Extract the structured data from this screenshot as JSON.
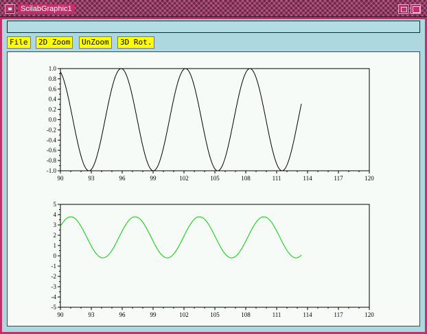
{
  "window": {
    "title": "ScilabGraphic1"
  },
  "menu": [
    {
      "name": "menu-file",
      "label": "File"
    },
    {
      "name": "menu-2d-zoom",
      "label": "2D Zoom"
    },
    {
      "name": "menu-unzoom",
      "label": "UnZoom"
    },
    {
      "name": "menu-3d-rot",
      "label": "3D Rot."
    }
  ],
  "info_text": "",
  "colors": {
    "plot1_line": "#000000",
    "plot2_line": "#00cc00",
    "canvas_bg": "#f7fbf7",
    "window_bg": "#add8e0"
  },
  "chart_data": [
    {
      "type": "line",
      "xlim": [
        90,
        120
      ],
      "ylim": [
        -1.0,
        1.0
      ],
      "x_ticks": [
        "90",
        "93",
        "96",
        "99",
        "102",
        "105",
        "108",
        "111",
        "114",
        "117",
        "120"
      ],
      "y_ticks": [
        "1.0",
        "0.8",
        "0.6",
        "0.4",
        "0.2",
        "0.0",
        "-0.2",
        "-0.4",
        "-0.6",
        "-0.8",
        "-1.0"
      ],
      "series": [
        {
          "function": "cos",
          "x_start": 90,
          "x_end": 113.4,
          "period": 6.25,
          "peak_at": 95.9,
          "amplitude": 1.0,
          "offset": 0.0,
          "color": "#000000"
        }
      ]
    },
    {
      "type": "line",
      "xlim": [
        90,
        120
      ],
      "ylim": [
        -5,
        5
      ],
      "x_ticks": [
        "90",
        "93",
        "96",
        "99",
        "102",
        "105",
        "108",
        "111",
        "114",
        "117",
        "120"
      ],
      "y_ticks": [
        "5",
        "4",
        "3",
        "2",
        "1",
        "0",
        "-1",
        "-2",
        "-3",
        "-4",
        "-5"
      ],
      "series": [
        {
          "function": "sin",
          "x_start": 90,
          "x_end": 113.4,
          "period": 6.25,
          "peak_at": 91.0,
          "amplitude": 2.0,
          "offset": 1.8,
          "color": "#00cc00"
        }
      ]
    }
  ]
}
